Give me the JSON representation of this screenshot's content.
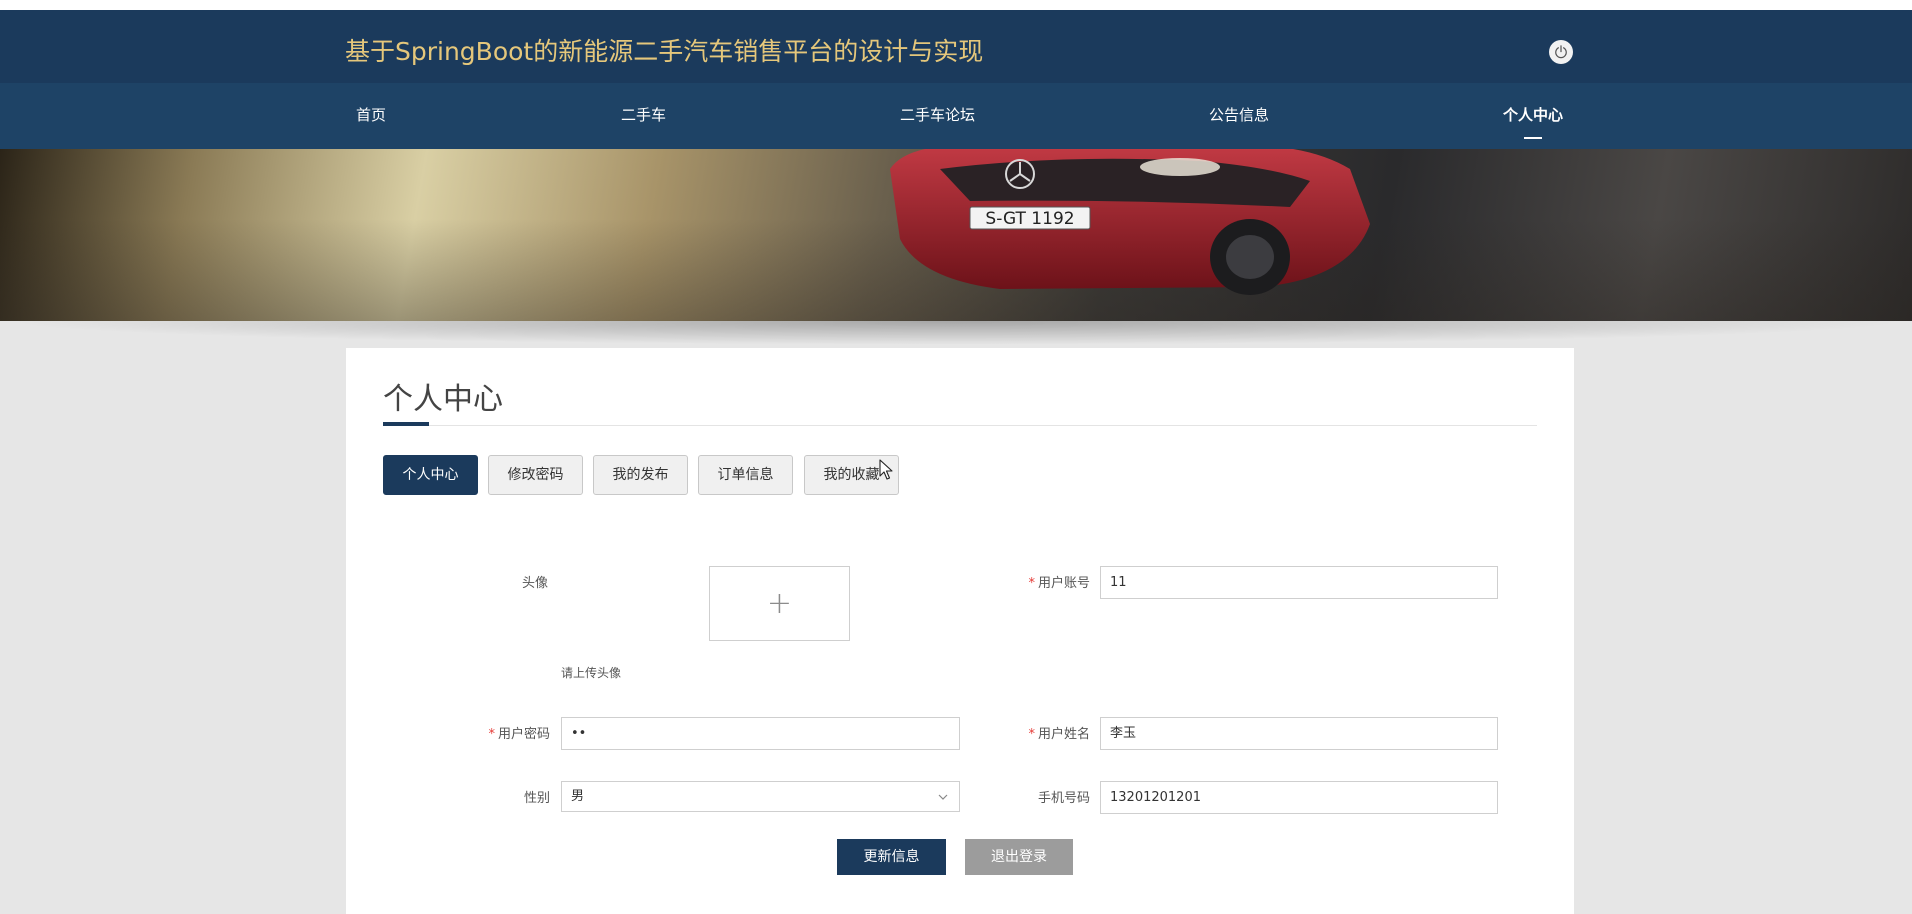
{
  "header": {
    "title": "基于SpringBoot的新能源二手汽车销售平台的设计与实现",
    "logout_icon": "power-icon"
  },
  "nav": {
    "items": [
      {
        "label": "首页"
      },
      {
        "label": "二手车"
      },
      {
        "label": "二手车论坛"
      },
      {
        "label": "公告信息"
      },
      {
        "label": "个人中心"
      }
    ],
    "active": "个人中心"
  },
  "banner": {
    "plate": "S-GT 1192",
    "slides": 3,
    "active_slide": 1
  },
  "panel": {
    "title": "个人中心",
    "tabs": [
      {
        "label": "个人中心"
      },
      {
        "label": "修改密码"
      },
      {
        "label": "我的发布"
      },
      {
        "label": "订单信息"
      },
      {
        "label": "我的收藏"
      }
    ],
    "active_tab": "个人中心"
  },
  "form": {
    "avatar_label": "头像",
    "avatar_hint": "请上传头像",
    "account_label": "用户账号",
    "account_value": "11",
    "password_label": "用户密码",
    "password_value": "••",
    "name_label": "用户姓名",
    "name_value": "李玉",
    "gender_label": "性别",
    "gender_value": "男",
    "phone_label": "手机号码",
    "phone_value": "13201201201",
    "required_mark": "*"
  },
  "actions": {
    "update_label": "更新信息",
    "logout_label": "退出登录"
  },
  "colors": {
    "header_bg": "#1b3a5c",
    "nav_bg": "#1e4366",
    "title_color": "#e5c77b",
    "primary": "#1b3a5c",
    "secondary": "#9c9c9c",
    "required": "#e53935"
  }
}
